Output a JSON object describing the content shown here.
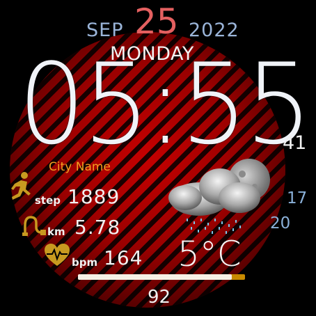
{
  "date": {
    "month": "SEP",
    "day": "25",
    "year": "2022",
    "weekday": "MONDAY"
  },
  "time": {
    "hhmm": "05:55",
    "seconds": "41"
  },
  "location": {
    "city": "City Name"
  },
  "activity": {
    "steps": {
      "label": "step",
      "value": "1889",
      "icon": "running-person-icon"
    },
    "distance": {
      "label": "km",
      "value": "5.78",
      "icon": "route-icon"
    },
    "heart": {
      "label": "bpm",
      "value": "164",
      "icon": "heart-pulse-icon"
    }
  },
  "weather": {
    "temperature": "5°C",
    "high": "17",
    "low": "20",
    "icon": "cloud-rain-moon-icon"
  },
  "battery": {
    "value": "92",
    "level_percent": 92
  },
  "colors": {
    "accent_date": "#e46060",
    "secondary": "#9ab4d8",
    "city": "#f2a020",
    "icon_gold": "#c89a20"
  }
}
